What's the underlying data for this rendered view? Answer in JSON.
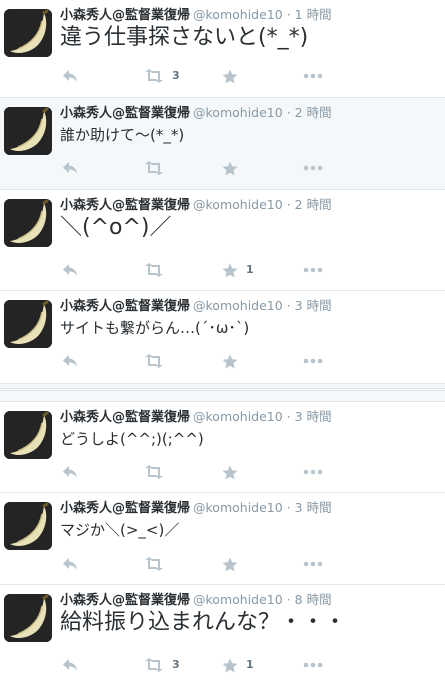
{
  "user": {
    "display_name": "小森秀人@監督業復帰",
    "handle": "@komohide10",
    "avatar_icon": "banana-avatar-icon"
  },
  "icons": {
    "reply": "reply-arrow-icon",
    "retweet": "retweet-icon",
    "favorite": "star-icon",
    "more": "more-dots-icon"
  },
  "colors": {
    "icon": "#b8c4cc",
    "name": "#292f33",
    "meta": "#8899a6",
    "highlight_bg": "#f5f8fa"
  },
  "tweets": [
    {
      "time": "1 時間",
      "text": "違う仕事探さないと(*_*)",
      "retweets": "3",
      "favorites": ""
    },
    {
      "time": "2 時間",
      "text": "誰か助けて〜(*_*)",
      "retweets": "",
      "favorites": ""
    },
    {
      "time": "2 時間",
      "text": "＼(^o^)／",
      "retweets": "",
      "favorites": "1"
    },
    {
      "time": "3 時間",
      "text": "サイトも繋がらん…(´･ω･`)",
      "retweets": "",
      "favorites": ""
    },
    {
      "time": "3 時間",
      "text": "どうしよ(^^;)(;^^)",
      "retweets": "",
      "favorites": ""
    },
    {
      "time": "3 時間",
      "text": "マジか＼(>_<)／",
      "retweets": "",
      "favorites": ""
    },
    {
      "time": "8 時間",
      "text": "給料振り込まれんな？・・・",
      "retweets": "3",
      "favorites": "1"
    }
  ]
}
